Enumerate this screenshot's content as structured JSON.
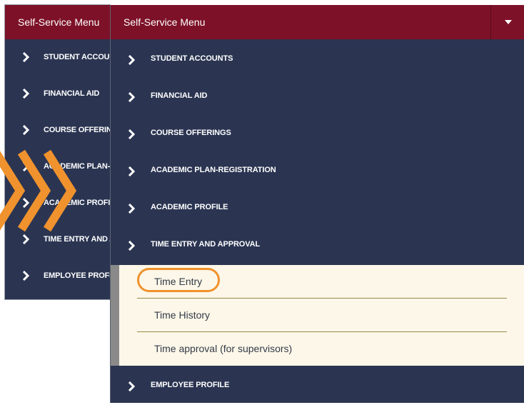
{
  "background_menu": {
    "title": "Self-Service Menu",
    "items": [
      {
        "label": "STUDENT ACCOUNTS"
      },
      {
        "label": "FINANCIAL AID"
      },
      {
        "label": "COURSE OFFERINGS"
      },
      {
        "label": "ACADEMIC PLAN-REGISTRATION"
      },
      {
        "label": "ACADEMIC PROFILE"
      },
      {
        "label": "TIME ENTRY AND APPROVAL"
      },
      {
        "label": "EMPLOYEE PROFILE"
      }
    ]
  },
  "menu": {
    "title": "Self-Service Menu",
    "items": [
      {
        "label": "STUDENT ACCOUNTS"
      },
      {
        "label": "FINANCIAL AID"
      },
      {
        "label": "COURSE OFFERINGS"
      },
      {
        "label": "ACADEMIC PLAN-REGISTRATION"
      },
      {
        "label": "ACADEMIC PROFILE"
      },
      {
        "label": "TIME ENTRY AND APPROVAL"
      }
    ],
    "submenu": [
      {
        "label": "Time Entry"
      },
      {
        "label": "Time History"
      },
      {
        "label": "Time approval (for supervisors)"
      }
    ],
    "last_item": {
      "label": "EMPLOYEE PROFILE"
    }
  },
  "icons": {
    "chevron": "chevron-right-icon",
    "caret": "caret-down-icon",
    "decoration": "triple-chevron-arrows"
  },
  "colors": {
    "header": "#7d1128",
    "menu_bg": "#2b3552",
    "submenu_bg": "#fcf7e8",
    "highlight": "#f0922d"
  }
}
